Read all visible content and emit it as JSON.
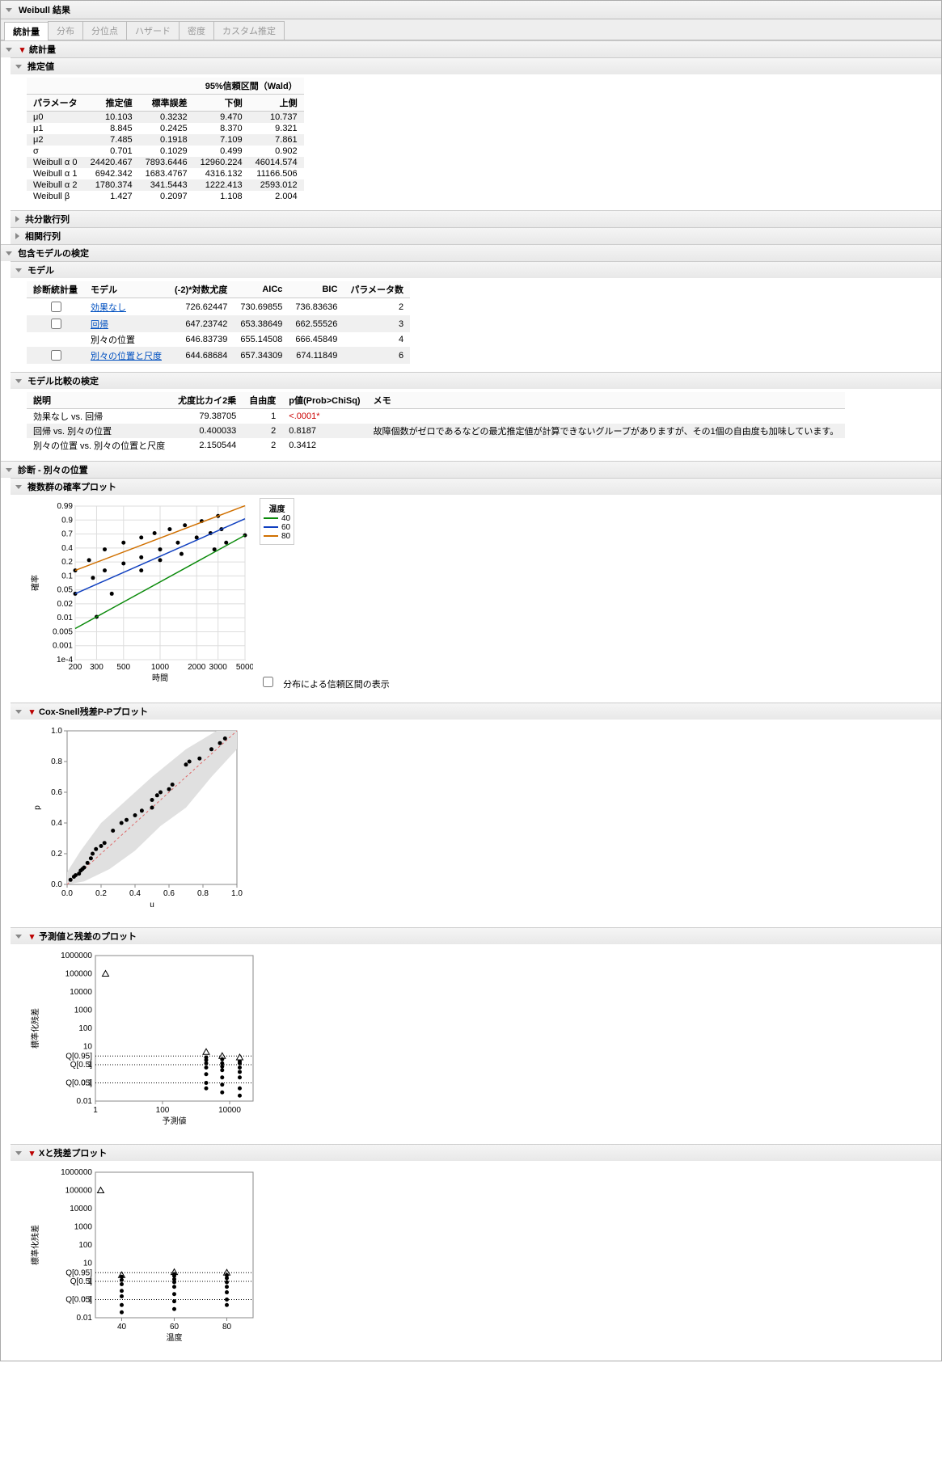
{
  "title": "Weibull 結果",
  "tabs": [
    "統計量",
    "分布",
    "分位点",
    "ハザード",
    "密度",
    "カスタム推定"
  ],
  "stats": {
    "hdr": "統計量",
    "est_hdr": "推定値",
    "ci_hdr": "95%信頼区間（Wald）",
    "cols": [
      "パラメータ",
      "推定値",
      "標準誤差",
      "下側",
      "上側"
    ],
    "rows": [
      {
        "p": "μ0",
        "e": "10.103",
        "se": "0.3232",
        "l": "9.470",
        "u": "10.737"
      },
      {
        "p": "μ1",
        "e": "8.845",
        "se": "0.2425",
        "l": "8.370",
        "u": "9.321"
      },
      {
        "p": "μ2",
        "e": "7.485",
        "se": "0.1918",
        "l": "7.109",
        "u": "7.861"
      },
      {
        "p": "σ",
        "e": "0.701",
        "se": "0.1029",
        "l": "0.499",
        "u": "0.902"
      },
      {
        "p": "Weibull α 0",
        "e": "24420.467",
        "se": "7893.6446",
        "l": "12960.224",
        "u": "46014.574"
      },
      {
        "p": "Weibull α 1",
        "e": "6942.342",
        "se": "1683.4767",
        "l": "4316.132",
        "u": "11166.506"
      },
      {
        "p": "Weibull α 2",
        "e": "1780.374",
        "se": "341.5443",
        "l": "1222.413",
        "u": "2593.012"
      },
      {
        "p": "Weibull β",
        "e": "1.427",
        "se": "0.2097",
        "l": "1.108",
        "u": "2.004"
      }
    ]
  },
  "cov": "共分散行列",
  "corr": "相関行列",
  "nest": "包含モデルの検定",
  "models": {
    "hdr": "モデル",
    "cols": [
      "診断統計量",
      "モデル",
      "(-2)*対数尤度",
      "AICc",
      "BIC",
      "パラメータ数"
    ],
    "rows": [
      {
        "cb": true,
        "m": "効果なし",
        "link": true,
        "ll": "726.62447",
        "aic": "730.69855",
        "bic": "736.83636",
        "k": "2"
      },
      {
        "cb": true,
        "m": "回帰",
        "link": true,
        "ll": "647.23742",
        "aic": "653.38649",
        "bic": "662.55526",
        "k": "3"
      },
      {
        "cb": false,
        "m": "別々の位置",
        "link": false,
        "ll": "646.83739",
        "aic": "655.14508",
        "bic": "666.45849",
        "k": "4"
      },
      {
        "cb": true,
        "m": "別々の位置と尺度",
        "link": true,
        "ll": "644.68684",
        "aic": "657.34309",
        "bic": "674.11849",
        "k": "6"
      }
    ]
  },
  "comp": {
    "hdr": "モデル比較の検定",
    "cols": [
      "説明",
      "尤度比カイ2乗",
      "自由度",
      "p値(Prob>ChiSq)",
      "メモ"
    ],
    "rows": [
      {
        "d": "効果なし vs. 回帰",
        "chi": "79.38705",
        "df": "1",
        "p": "<.0001*",
        "note": "",
        "red": true
      },
      {
        "d": "回帰 vs. 別々の位置",
        "chi": "0.400033",
        "df": "2",
        "p": "0.8187",
        "note": "故障個数がゼロであるなどの最尤推定値が計算できないグループがありますが、その1個の自由度も加味しています。"
      },
      {
        "d": "別々の位置 vs. 別々の位置と尺度",
        "chi": "2.150544",
        "df": "2",
        "p": "0.3412",
        "note": ""
      }
    ]
  },
  "diag_hdr": "診断 - 別々の位置",
  "prob_plot": {
    "hdr": "複数群の確率プロット",
    "legend_title": "温度",
    "legend": [
      {
        "v": "40",
        "c": "#0a8a0a"
      },
      {
        "v": "60",
        "c": "#1040c0"
      },
      {
        "v": "80",
        "c": "#d07000"
      }
    ],
    "xlabel": "時間",
    "ylabel": "確率",
    "yticks": [
      "0.99",
      "0.9",
      "0.7",
      "0.4",
      "0.2",
      "0.1",
      "0.05",
      "0.02",
      "0.01",
      "0.005",
      "0.001",
      "1e-4"
    ],
    "xticks": [
      "200",
      "300",
      "500",
      "1000",
      "2000",
      "3000",
      "5000"
    ],
    "ci_cb": "分布による信頼区間の表示"
  },
  "coxsnell": {
    "hdr": "Cox-Snell残差P-Pプロット",
    "xlabel": "u",
    "ylabel": "p",
    "ticks": [
      "0.0",
      "0.2",
      "0.4",
      "0.6",
      "0.8",
      "1.0"
    ]
  },
  "predres": {
    "hdr": "予測値と残差のプロット",
    "ylabel": "標準化残差",
    "xlabel": "予測値",
    "xticks": [
      "1",
      "100",
      "10000"
    ],
    "yticks": [
      "1000000",
      "100000",
      "10000",
      "1000",
      "100",
      "10",
      "Q[0.95]",
      "Q[0.50]",
      "1",
      "Q[0.05]",
      "0.1",
      "0.01"
    ]
  },
  "xres": {
    "hdr": "Xと残差プロット",
    "ylabel": "標準化残差",
    "xlabel": "温度",
    "xticks": [
      "40",
      "60",
      "80"
    ],
    "yticks": [
      "1000000",
      "100000",
      "10000",
      "1000",
      "100",
      "10",
      "Q[0.95]",
      "Q[0.50]",
      "1",
      "Q[0.05]",
      "0.1",
      "0.01"
    ]
  },
  "chart_data": [
    {
      "type": "line",
      "name": "probability_plot",
      "xlabel": "時間",
      "ylabel": "確率",
      "x_scale": "log",
      "y_scale": "weibull",
      "series": [
        {
          "name": "40",
          "color": "#0a8a0a",
          "points": [
            [
              300,
              0.002
            ],
            [
              400,
              0.01
            ],
            [
              700,
              0.05
            ],
            [
              1000,
              0.1
            ],
            [
              1500,
              0.15
            ],
            [
              2800,
              0.2
            ],
            [
              3500,
              0.3
            ],
            [
              5000,
              0.45
            ]
          ]
        },
        {
          "name": "60",
          "color": "#1040c0",
          "points": [
            [
              200,
              0.01
            ],
            [
              280,
              0.03
            ],
            [
              350,
              0.05
            ],
            [
              500,
              0.08
            ],
            [
              700,
              0.12
            ],
            [
              1000,
              0.2
            ],
            [
              1400,
              0.3
            ],
            [
              2000,
              0.4
            ],
            [
              2600,
              0.5
            ],
            [
              3200,
              0.6
            ]
          ]
        },
        {
          "name": "80",
          "color": "#d07000",
          "points": [
            [
              200,
              0.05
            ],
            [
              260,
              0.1
            ],
            [
              350,
              0.2
            ],
            [
              500,
              0.3
            ],
            [
              700,
              0.4
            ],
            [
              900,
              0.5
            ],
            [
              1200,
              0.6
            ],
            [
              1600,
              0.7
            ],
            [
              2200,
              0.8
            ],
            [
              3000,
              0.9
            ]
          ]
        }
      ]
    },
    {
      "type": "scatter",
      "name": "cox_snell_pp",
      "xlabel": "u",
      "ylabel": "p",
      "xlim": [
        0,
        1
      ],
      "ylim": [
        0,
        1
      ],
      "points": [
        [
          0.02,
          0.03
        ],
        [
          0.04,
          0.05
        ],
        [
          0.05,
          0.06
        ],
        [
          0.07,
          0.07
        ],
        [
          0.08,
          0.09
        ],
        [
          0.09,
          0.1
        ],
        [
          0.1,
          0.11
        ],
        [
          0.12,
          0.14
        ],
        [
          0.14,
          0.17
        ],
        [
          0.15,
          0.2
        ],
        [
          0.17,
          0.23
        ],
        [
          0.2,
          0.25
        ],
        [
          0.22,
          0.27
        ],
        [
          0.27,
          0.35
        ],
        [
          0.32,
          0.4
        ],
        [
          0.35,
          0.42
        ],
        [
          0.4,
          0.45
        ],
        [
          0.44,
          0.48
        ],
        [
          0.5,
          0.5
        ],
        [
          0.5,
          0.55
        ],
        [
          0.53,
          0.58
        ],
        [
          0.55,
          0.6
        ],
        [
          0.6,
          0.62
        ],
        [
          0.62,
          0.65
        ],
        [
          0.7,
          0.78
        ],
        [
          0.72,
          0.8
        ],
        [
          0.78,
          0.82
        ],
        [
          0.85,
          0.88
        ],
        [
          0.9,
          0.92
        ],
        [
          0.93,
          0.95
        ]
      ]
    },
    {
      "type": "scatter",
      "name": "pred_vs_resid",
      "xlabel": "予測値",
      "ylabel": "標準化残差",
      "x_scale": "log",
      "y_scale": "log",
      "xlim": [
        1,
        50000
      ],
      "ylim": [
        0.01,
        1000000
      ],
      "qlines": [
        0.05,
        0.5,
        0.95
      ],
      "points": [
        [
          2000,
          0.05
        ],
        [
          2000,
          0.1
        ],
        [
          2000,
          0.3
        ],
        [
          2000,
          0.7
        ],
        [
          2000,
          1.2
        ],
        [
          2000,
          1.8
        ],
        [
          2000,
          2.5
        ],
        [
          6000,
          0.03
        ],
        [
          6000,
          0.08
        ],
        [
          6000,
          0.2
        ],
        [
          6000,
          0.5
        ],
        [
          6000,
          0.8
        ],
        [
          6000,
          1.2
        ],
        [
          6000,
          2
        ],
        [
          20000,
          0.02
        ],
        [
          20000,
          0.05
        ],
        [
          20000,
          0.2
        ],
        [
          20000,
          0.4
        ],
        [
          20000,
          0.7
        ],
        [
          20000,
          1.2
        ],
        [
          20000,
          1.5
        ]
      ],
      "censored": [
        [
          2,
          100000
        ],
        [
          2000,
          5
        ],
        [
          6000,
          3
        ],
        [
          20000,
          2.5
        ]
      ]
    },
    {
      "type": "scatter",
      "name": "x_vs_resid",
      "xlabel": "温度",
      "ylabel": "標準化残差",
      "y_scale": "log",
      "xlim": [
        30,
        90
      ],
      "ylim": [
        0.01,
        1000000
      ],
      "qlines": [
        0.05,
        0.5,
        0.95
      ],
      "x_values": [
        40,
        60,
        80
      ],
      "points": [
        [
          40,
          0.02
        ],
        [
          40,
          0.05
        ],
        [
          40,
          0.15
        ],
        [
          40,
          0.3
        ],
        [
          40,
          0.7
        ],
        [
          40,
          1.2
        ],
        [
          40,
          1.8
        ],
        [
          60,
          0.03
        ],
        [
          60,
          0.08
        ],
        [
          60,
          0.2
        ],
        [
          60,
          0.5
        ],
        [
          60,
          0.9
        ],
        [
          60,
          1.3
        ],
        [
          60,
          2
        ],
        [
          60,
          2.5
        ],
        [
          80,
          0.05
        ],
        [
          80,
          0.1
        ],
        [
          80,
          0.25
        ],
        [
          80,
          0.5
        ],
        [
          80,
          0.9
        ],
        [
          80,
          1.5
        ],
        [
          80,
          2.2
        ]
      ],
      "censored": [
        [
          32,
          100000
        ],
        [
          40,
          2.2
        ],
        [
          60,
          3.2
        ],
        [
          80,
          3
        ]
      ]
    }
  ]
}
